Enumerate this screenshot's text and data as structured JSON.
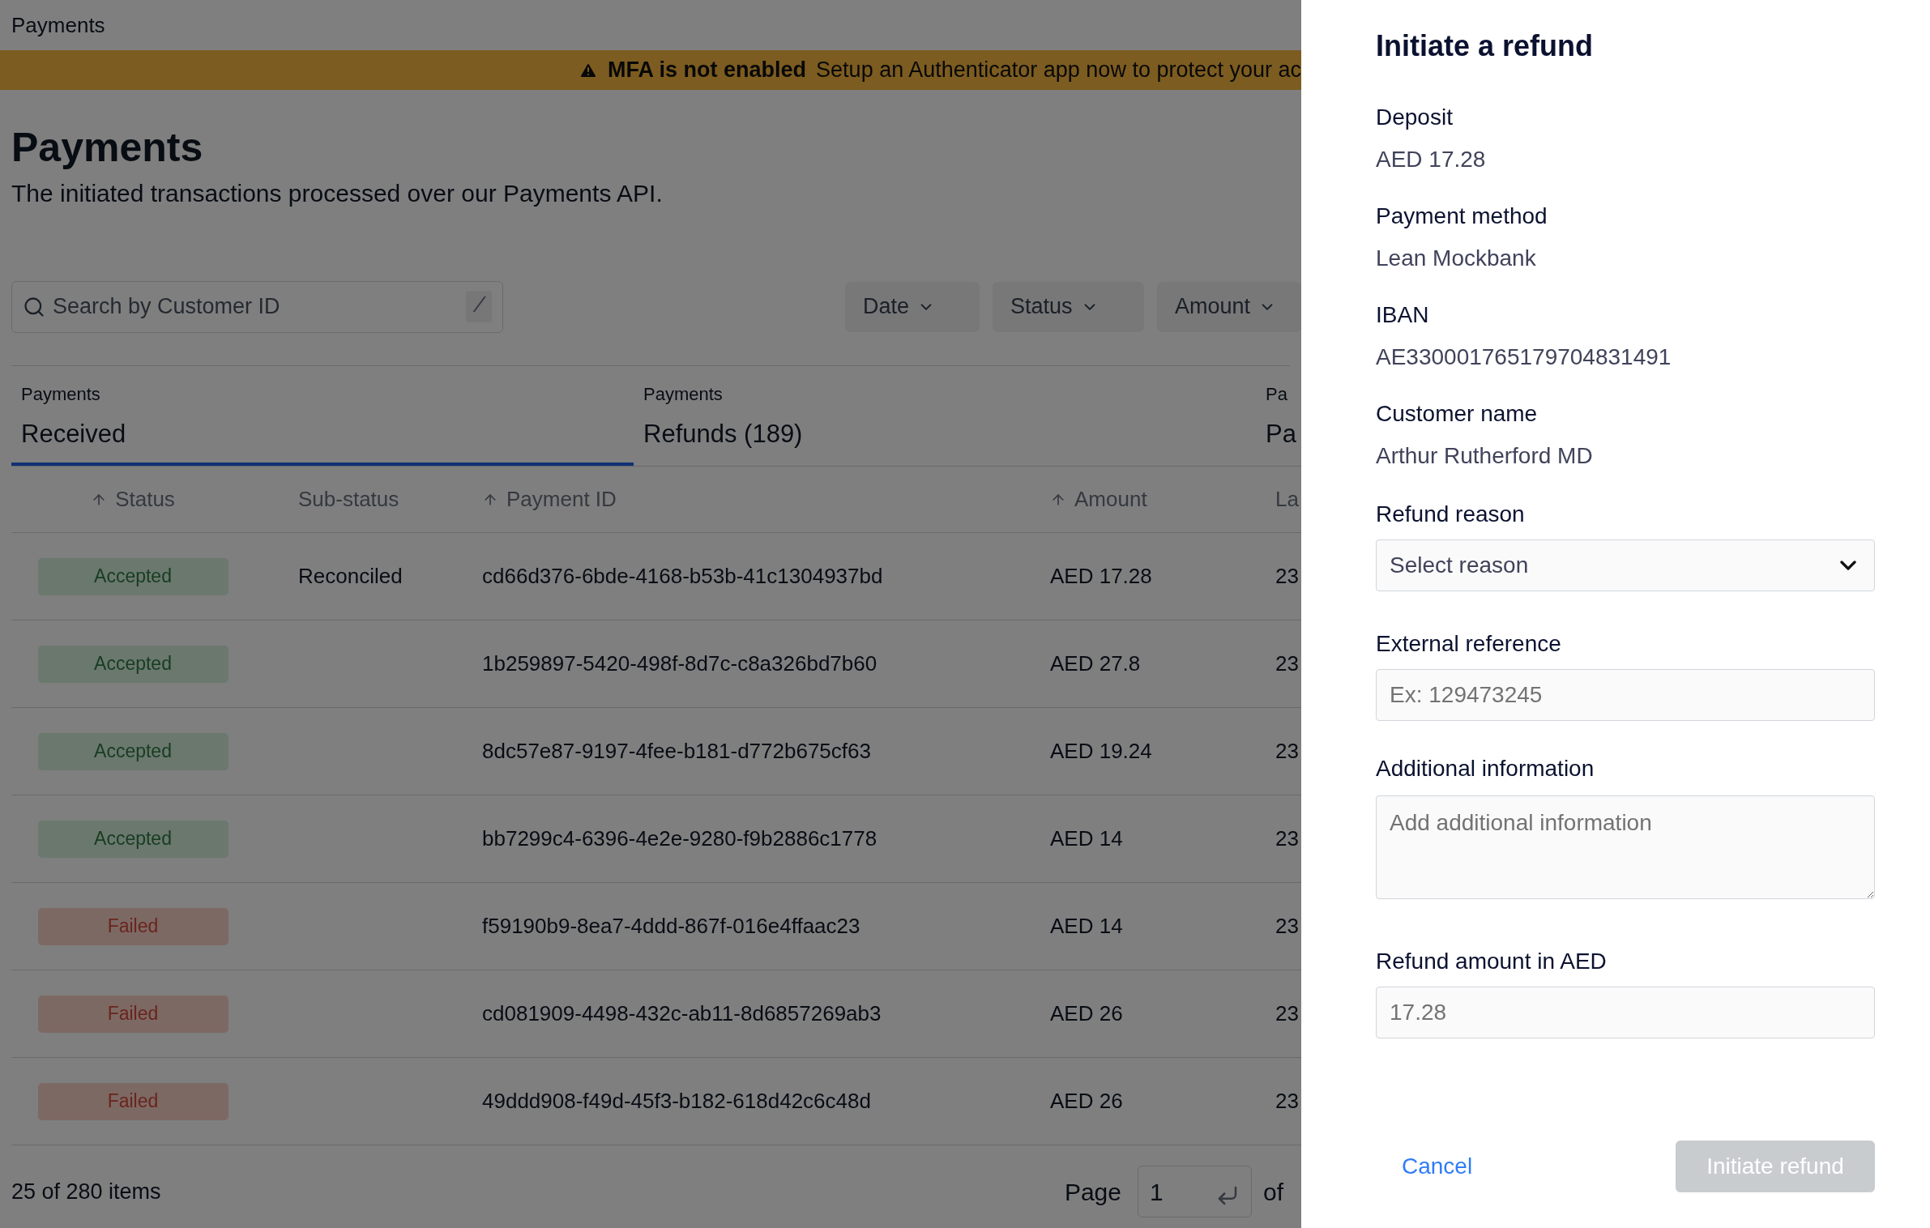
{
  "breadcrumb": "Payments",
  "banner": {
    "title": "MFA is not enabled",
    "message": "Setup an Authenticator app now to protect your ac"
  },
  "page": {
    "title": "Payments",
    "subtitle": "The initiated transactions processed over our Payments API."
  },
  "search": {
    "placeholder": "Search by Customer ID",
    "shortcut": "/"
  },
  "filters": [
    "Date",
    "Status",
    "Amount"
  ],
  "tabs": [
    {
      "caption": "Payments",
      "label": "Received",
      "selected": true
    },
    {
      "caption": "Payments",
      "label": "Refunds (189)",
      "selected": false
    },
    {
      "caption": "Pa",
      "label": "Pa",
      "selected": false
    }
  ],
  "table": {
    "columns": [
      {
        "label": "Status",
        "sortable": true
      },
      {
        "label": "Sub-status",
        "sortable": false
      },
      {
        "label": "Payment ID",
        "sortable": true
      },
      {
        "label": "Amount",
        "sortable": true
      },
      {
        "label": "La",
        "sortable": false
      }
    ],
    "rows": [
      {
        "status": "Accepted",
        "kind": "success",
        "sub_status": "Reconciled",
        "payment_id": "cd66d376-6bde-4168-b53b-41c1304937bd",
        "amount": "AED 17.28",
        "column_5": "23"
      },
      {
        "status": "Accepted",
        "kind": "success",
        "payment_id": "1b259897-5420-498f-8d7c-c8a326bd7b60",
        "amount": "AED 27.8",
        "column_5": "23"
      },
      {
        "status": "Accepted",
        "kind": "success",
        "payment_id": "8dc57e87-9197-4fee-b181-d772b675cf63",
        "amount": "AED 19.24",
        "column_5": "23"
      },
      {
        "status": "Accepted",
        "kind": "success",
        "payment_id": "bb7299c4-6396-4e2e-9280-f9b2886c1778",
        "amount": "AED 14",
        "column_5": "23"
      },
      {
        "status": "Failed",
        "kind": "error",
        "payment_id": "f59190b9-8ea7-4ddd-867f-016e4ffaac23",
        "amount": "AED 14",
        "column_5": "23"
      },
      {
        "status": "Failed",
        "kind": "error",
        "payment_id": "cd081909-4498-432c-ab11-8d6857269ab3",
        "amount": "AED 26",
        "column_5": "23"
      },
      {
        "status": "Failed",
        "kind": "error",
        "payment_id": "49ddd908-f49d-45f3-b182-618d42c6c48d",
        "amount": "AED 26",
        "column_5": "23"
      }
    ]
  },
  "footer": {
    "count": "25 of 280 items",
    "page_label": "Page",
    "page_value": "1",
    "of": "of"
  },
  "drawer": {
    "title": "Initiate a refund",
    "details": [
      {
        "label": "Deposit",
        "value": "AED 17.28"
      },
      {
        "label": "Payment method",
        "value": "Lean Mockbank"
      },
      {
        "label": "IBAN",
        "value": "AE330001765179704831491"
      },
      {
        "label": "Customer name",
        "value": "Arthur Rutherford MD"
      }
    ],
    "refund_reason": {
      "label": "Refund reason",
      "placeholder": "Select reason"
    },
    "external_reference": {
      "label": "External reference",
      "placeholder": "Ex: 129473245"
    },
    "additional_information": {
      "label": "Additional information",
      "placeholder": "Add additional information"
    },
    "refund_amount": {
      "label": "Refund amount in AED",
      "placeholder": "17.28"
    },
    "cancel": "Cancel",
    "submit": {
      "label": "Initiate refund",
      "disabled": true
    }
  }
}
